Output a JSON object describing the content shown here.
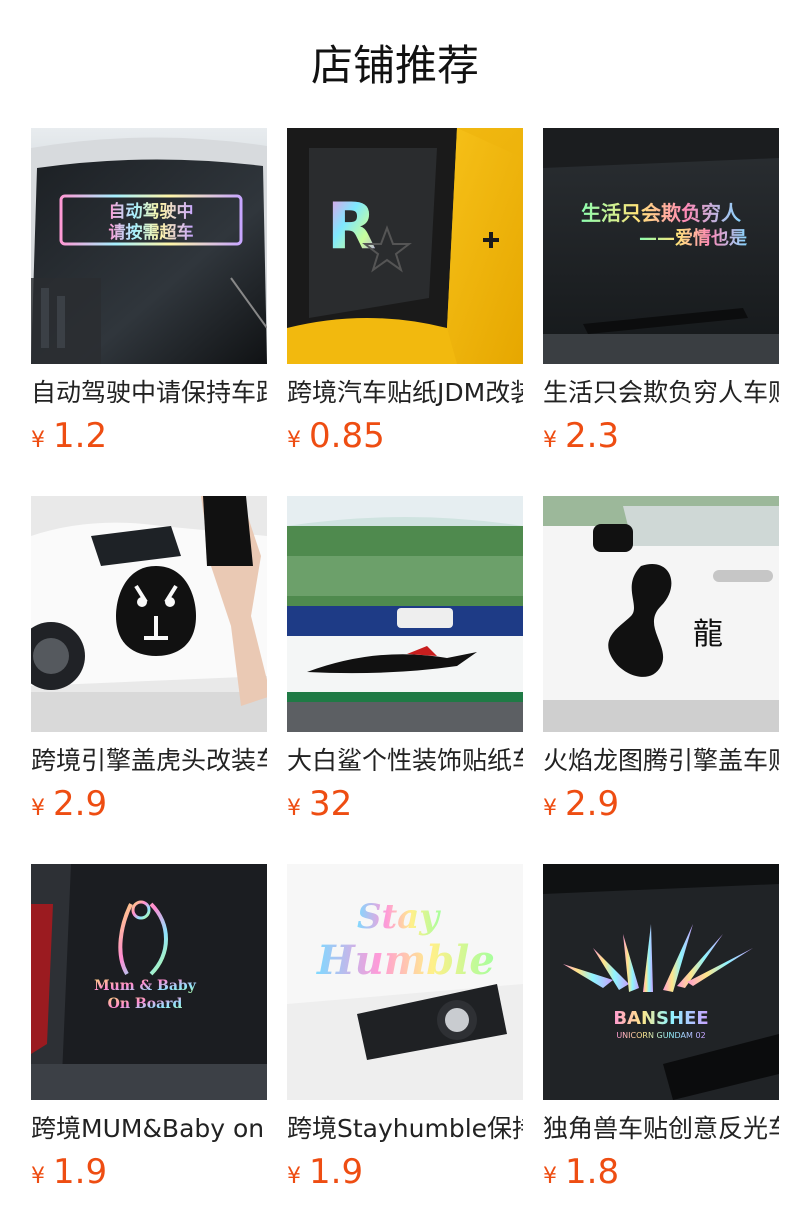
{
  "section": {
    "title": "店铺推荐"
  },
  "currency_symbol": "¥",
  "products": [
    {
      "name": "自动驾驶中请保持车距",
      "price": "1.2",
      "image_text": [
        "自动驾驶中",
        "请按需超车"
      ]
    },
    {
      "name": "跨境汽车贴纸JDM改装",
      "price": "0.85",
      "image_text": [
        "R"
      ]
    },
    {
      "name": "生活只会欺负穷人车贴",
      "price": "2.3",
      "image_text": [
        "生活只会欺负穷人",
        "——爱情也是"
      ]
    },
    {
      "name": "跨境引擎盖虎头改装车贴",
      "price": "2.9",
      "image_text": []
    },
    {
      "name": "大白鲨个性装饰贴纸车贴",
      "price": "32",
      "image_text": []
    },
    {
      "name": "火焰龙图腾引擎盖车贴",
      "price": "2.9",
      "image_text": [
        "龍"
      ]
    },
    {
      "name": "跨境MUM&Baby on board",
      "price": "1.9",
      "image_text": [
        "Mum & Baby",
        "On Board"
      ]
    },
    {
      "name": "跨境Stayhumble保持谦逊",
      "price": "1.9",
      "image_text": [
        "Stay",
        "Humble"
      ]
    },
    {
      "name": "独角兽车贴创意反光车贴",
      "price": "1.8",
      "image_text": [
        "BANSHEE",
        "UNICORN GUNDAM 02"
      ]
    }
  ],
  "colors": {
    "price": "#ee4d12",
    "title": "#111111",
    "name": "#222222"
  }
}
